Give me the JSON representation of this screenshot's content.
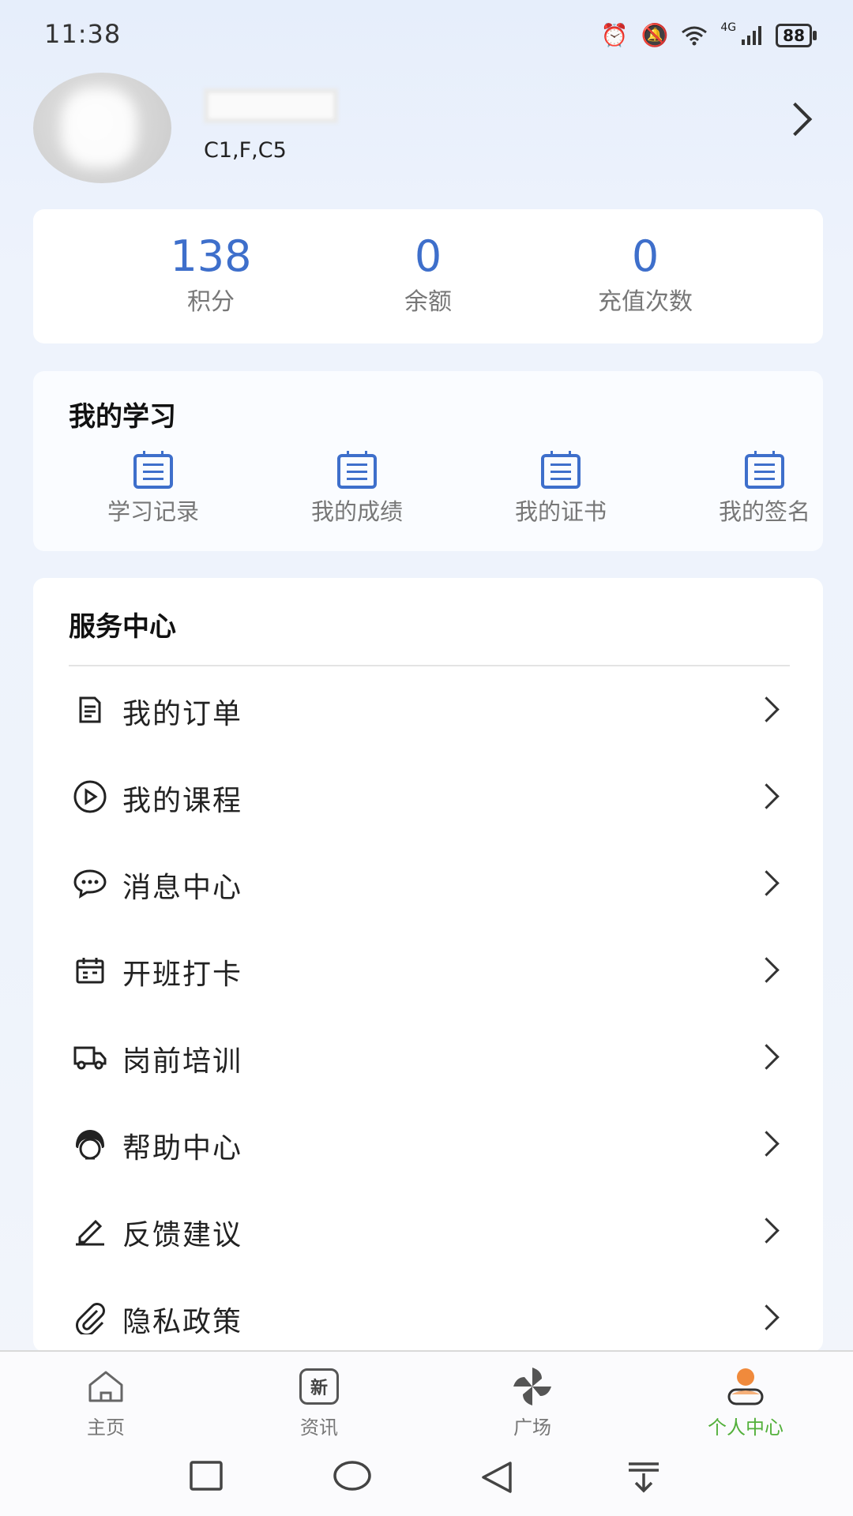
{
  "status": {
    "time": "11:38",
    "battery": "88",
    "network": "4G"
  },
  "profile": {
    "name": "",
    "license_classes": "C1,F,C5"
  },
  "stats": [
    {
      "value": "138",
      "label": "积分"
    },
    {
      "value": "0",
      "label": "余额"
    },
    {
      "value": "0",
      "label": "充值次数"
    }
  ],
  "study": {
    "title": "我的学习",
    "items": [
      {
        "label": "学习记录",
        "icon": "document-icon"
      },
      {
        "label": "我的成绩",
        "icon": "document-icon"
      },
      {
        "label": "我的证书",
        "icon": "document-icon"
      },
      {
        "label": "我的签名",
        "icon": "document-icon"
      }
    ]
  },
  "service": {
    "title": "服务中心",
    "items": [
      {
        "label": "我的订单",
        "icon": "order-icon"
      },
      {
        "label": "我的课程",
        "icon": "play-icon"
      },
      {
        "label": "消息中心",
        "icon": "chat-icon"
      },
      {
        "label": "开班打卡",
        "icon": "calendar-icon"
      },
      {
        "label": "岗前培训",
        "icon": "truck-icon"
      },
      {
        "label": "帮助中心",
        "icon": "support-icon"
      },
      {
        "label": "反馈建议",
        "icon": "pencil-icon"
      },
      {
        "label": "隐私政策",
        "icon": "paperclip-icon"
      }
    ]
  },
  "tabs": [
    {
      "label": "主页",
      "icon": "home-icon"
    },
    {
      "label": "资讯",
      "icon": "news-icon",
      "icon_text": "新"
    },
    {
      "label": "广场",
      "icon": "pinwheel-icon"
    },
    {
      "label": "个人中心",
      "icon": "person-icon",
      "active": true
    }
  ],
  "colors": {
    "accent": "#3e6fcb",
    "active_tab": "#53b03b",
    "person_icon": "#f08a3c"
  }
}
